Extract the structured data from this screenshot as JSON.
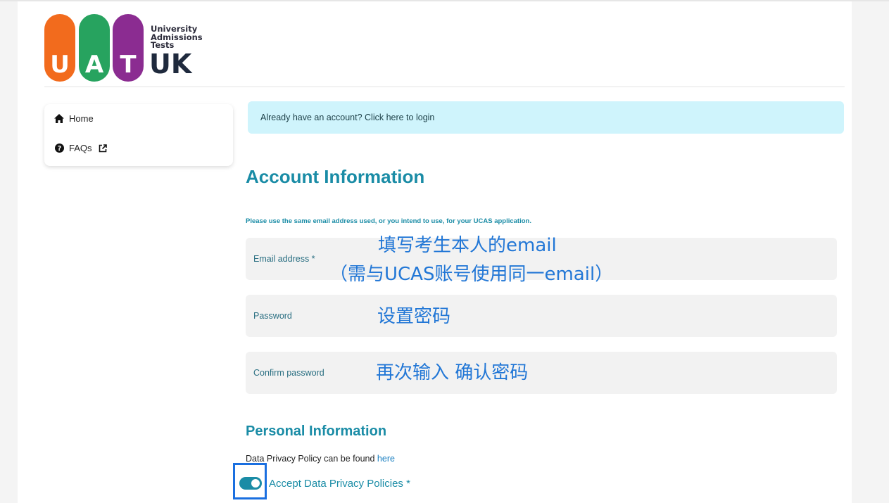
{
  "logo": {
    "letters": [
      "U",
      "A",
      "T"
    ],
    "small_lines": [
      "University",
      "Admissions",
      "Tests"
    ],
    "country": "UK",
    "colors": {
      "u": "#f26b1d",
      "a": "#27a35f",
      "t": "#8b2c91"
    }
  },
  "sidebar": {
    "items": [
      {
        "label": "Home",
        "icon": "home-icon"
      },
      {
        "label": "FAQs",
        "icon": "question-circle-icon",
        "trailing_icon": "external-link-icon"
      }
    ]
  },
  "alert": {
    "text": "Already have an account? Click here to login"
  },
  "account": {
    "heading": "Account Information",
    "note": "Please use the same email address used, or you intend to use, for your UCAS application.",
    "fields": [
      {
        "label": "Email address *",
        "value": ""
      },
      {
        "label": "Password",
        "value": ""
      },
      {
        "label": "Confirm password",
        "value": ""
      }
    ]
  },
  "annotations": {
    "email_line1": "填写考生本人的email",
    "email_line2": "（需与UCAS账号使用同一email）",
    "password": "设置密码",
    "confirm": "再次输入 确认密码"
  },
  "personal": {
    "heading": "Personal Information",
    "privacy_prefix": "Data Privacy Policy can be found",
    "privacy_link": "here",
    "toggle_label": "Accept Data Privacy Policies *",
    "toggle_on": true
  },
  "colors": {
    "accent": "#1a8ca6",
    "alert_bg": "#cff4fc",
    "annotation": "#2277d6",
    "highlight_box": "#1a6fe0"
  }
}
